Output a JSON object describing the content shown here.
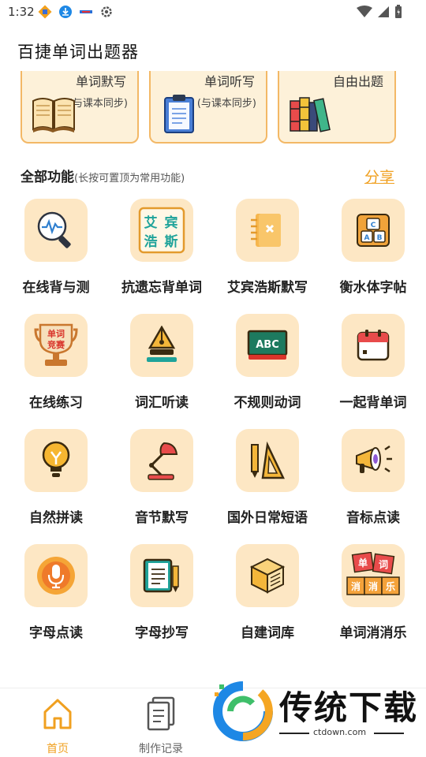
{
  "status_bar": {
    "time": "1:32"
  },
  "app_bar": {
    "title": "百捷单词出题器"
  },
  "top_cards": [
    {
      "title": "单词默写",
      "subtitle": "(与课本同步)",
      "icon": "open-book-icon"
    },
    {
      "title": "单词听写",
      "subtitle": "(与课本同步)",
      "icon": "clipboard-icon"
    },
    {
      "title": "自由出题",
      "subtitle": "",
      "icon": "books-icon"
    }
  ],
  "section": {
    "title": "全部功能",
    "hint": "(长按可置顶为常用功能)",
    "share_label": "分享"
  },
  "tiles": [
    {
      "label": "在线背与测",
      "icon": "magnifier-pulse-icon"
    },
    {
      "label": "抗遗忘背单词",
      "icon": "ebbinghaus-icon",
      "icon_text": [
        "艾",
        "宾",
        "浩",
        "斯"
      ]
    },
    {
      "label": "艾宾浩斯默写",
      "icon": "notebook-x-icon"
    },
    {
      "label": "衡水体字帖",
      "icon": "abc-blocks-icon"
    },
    {
      "label": "在线练习",
      "icon": "trophy-icon",
      "icon_text": [
        "单词",
        "竞赛"
      ]
    },
    {
      "label": "词汇听读",
      "icon": "pen-nib-icon"
    },
    {
      "label": "不规则动词",
      "icon": "chalkboard-icon",
      "icon_text": [
        "ABC"
      ]
    },
    {
      "label": "一起背单词",
      "icon": "calendar-icon"
    },
    {
      "label": "自然拼读",
      "icon": "lightbulb-icon"
    },
    {
      "label": "音节默写",
      "icon": "desk-lamp-icon"
    },
    {
      "label": "国外日常短语",
      "icon": "ruler-pencil-icon"
    },
    {
      "label": "音标点读",
      "icon": "megaphone-icon"
    },
    {
      "label": "字母点读",
      "icon": "microphone-icon"
    },
    {
      "label": "字母抄写",
      "icon": "notebook-pencil-icon"
    },
    {
      "label": "自建词库",
      "icon": "box-book-icon"
    },
    {
      "label": "单词消消乐",
      "icon": "word-blocks-icon",
      "icon_text": [
        "单",
        "词",
        "消",
        "消",
        "乐"
      ]
    }
  ],
  "bottom_nav": [
    {
      "label": "首页",
      "icon": "home-icon",
      "active": true
    },
    {
      "label": "制作记录",
      "icon": "document-icon",
      "active": false
    }
  ],
  "watermark": {
    "text": "传统下载",
    "url": "ctdown.com"
  },
  "colors": {
    "accent": "#f0a020",
    "tile_bg": "#fde7c4",
    "card_bg": "#fdf1d9"
  }
}
